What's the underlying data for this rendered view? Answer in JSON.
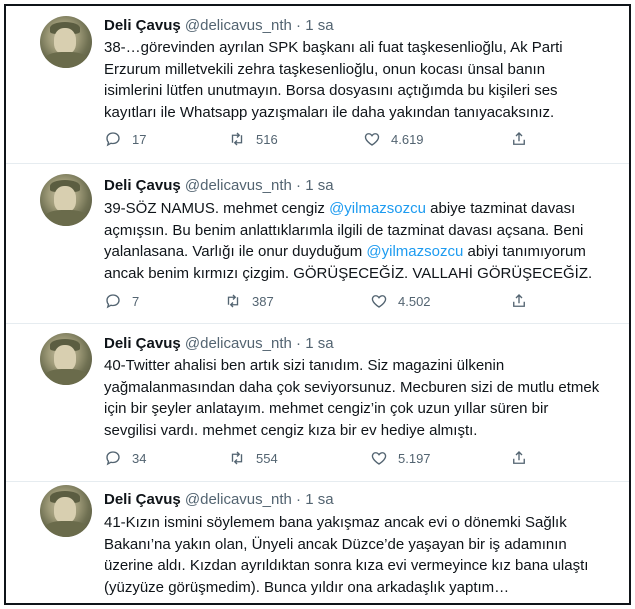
{
  "colors": {
    "link": "#1d9bf0",
    "secondary": "#536471",
    "text": "#0f1419"
  },
  "tweets": [
    {
      "name": "Deli Çavuş",
      "handle": "@delicavus_nth",
      "dot": "·",
      "time": "1 sa",
      "segments": [
        {
          "t": "38-…görevinden ayrılan SPK başkanı ali fuat taşkesenlioğlu, Ak Parti Erzurum milletvekili zehra taşkesenlioğlu, onun kocası ünsal banın isimlerini lütfen unutmayın. Borsa dosyasını açtığımda bu kişileri ses kayıtları ile Whatsapp yazışmaları ile daha yakından tanıyacaksınız."
        }
      ],
      "replies": "17",
      "retweets": "516",
      "likes": "4.619"
    },
    {
      "name": "Deli Çavuş",
      "handle": "@delicavus_nth",
      "dot": "·",
      "time": "1 sa",
      "segments": [
        {
          "t": "39-SÖZ NAMUS. mehmet cengiz "
        },
        {
          "t": "@yilmazsozcu",
          "mention": true
        },
        {
          "t": " abiye tazminat davası açmışsın. Bu benim anlattıklarımla ilgili de tazminat davası açsana. Beni yalanlasana. Varlığı ile onur duyduğum "
        },
        {
          "t": "@yilmazsozcu",
          "mention": true
        },
        {
          "t": " abiyi tanımıyorum ancak benim kırmızı çizgim. GÖRÜŞECEĞİZ. VALLAHİ GÖRÜŞECEĞİZ."
        }
      ],
      "replies": "7",
      "retweets": "387",
      "likes": "4.502"
    },
    {
      "name": "Deli Çavuş",
      "handle": "@delicavus_nth",
      "dot": "·",
      "time": "1 sa",
      "segments": [
        {
          "t": "40-Twitter ahalisi ben artık sizi tanıdım. Siz magazini ülkenin yağmalanmasından daha çok seviyorsunuz. Mecburen sizi de mutlu etmek için bir şeyler anlatayım. mehmet cengiz’in çok uzun yıllar süren bir sevgilisi vardı. mehmet cengiz kıza bir ev hediye almıştı."
        }
      ],
      "replies": "34",
      "retweets": "554",
      "likes": "5.197"
    },
    {
      "name": "Deli Çavuş",
      "handle": "@delicavus_nth",
      "dot": "·",
      "time": "1 sa",
      "segments": [
        {
          "t": "41-Kızın ismini söylemem bana yakışmaz ancak evi o dönemki Sağlık Bakanı’na yakın olan, Ünyeli ancak Düzce’de yaşayan bir iş adamının üzerine aldı. Kızdan ayrıldıktan sonra kıza evi vermeyince kız bana ulaştı (yüzyüze görüşmedim). Bunca yıldır ona arkadaşlık yaptım…"
        }
      ],
      "replies": "",
      "retweets": "",
      "likes": ""
    }
  ]
}
